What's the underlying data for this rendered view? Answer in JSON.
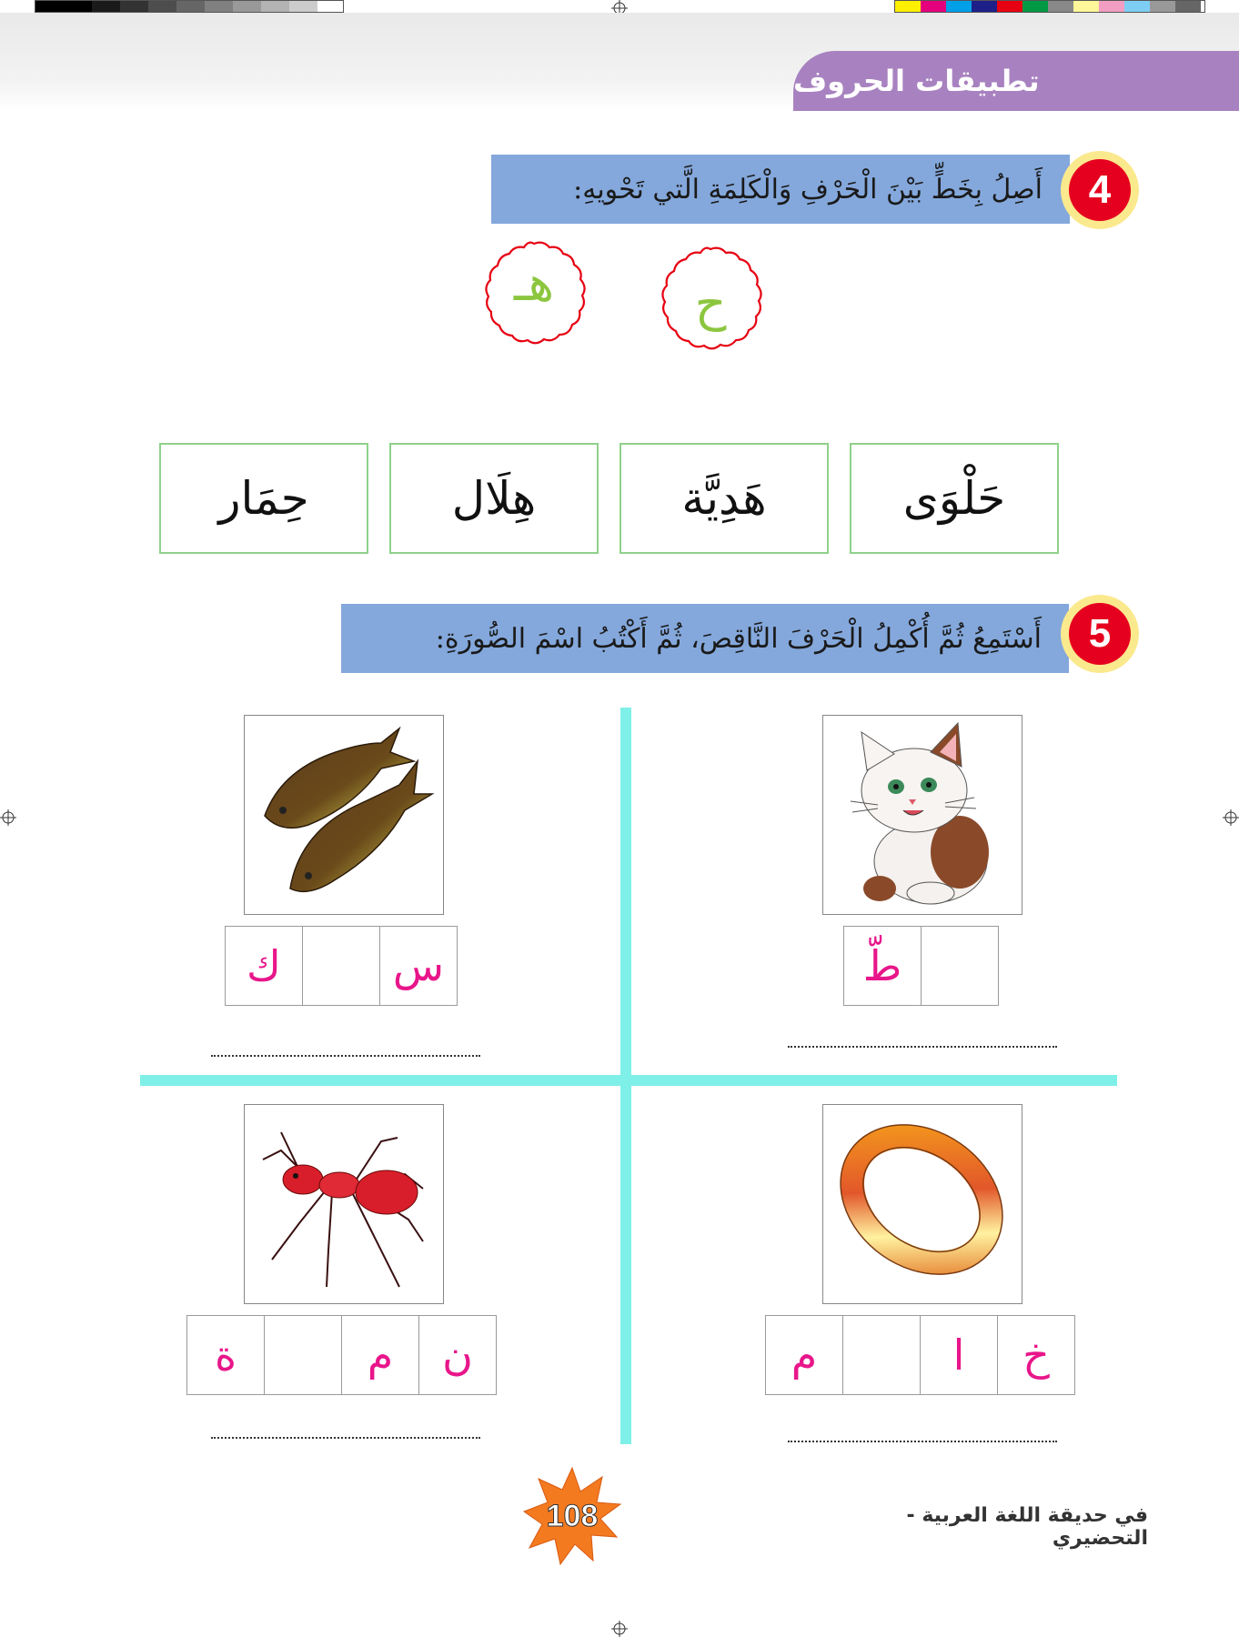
{
  "header": {
    "title": "تطبيقات الحروف"
  },
  "q4": {
    "number": "4",
    "instruction": "أَصِلُ بِخَطٍّ بَيْنَ الْحَرْفِ وَالْكَلِمَةِ الَّتي تَحْويهِ:",
    "letters": [
      "ح",
      "هـ"
    ],
    "words": [
      "حَلْوَى",
      "هَدِيَّة",
      "هِلَال",
      "حِمَار"
    ]
  },
  "q5": {
    "number": "5",
    "instruction": "أَسْتَمِعُ ثُمَّ أُكْمِلُ الْحَرْفَ النَّاقِصَ، ثُمَّ أَكْتُبُ اسْمَ الصُّورَةِ:",
    "items": [
      {
        "picture": "cat-picture",
        "cells": [
          "",
          "طّ"
        ]
      },
      {
        "picture": "fish-picture",
        "cells": [
          "س",
          "",
          "ك"
        ]
      },
      {
        "picture": "ring-picture",
        "cells": [
          "خ",
          "ا",
          "",
          "م"
        ]
      },
      {
        "picture": "ant-picture",
        "cells": [
          "ن",
          "م",
          "",
          "ة"
        ]
      }
    ],
    "answer_line": "................................................"
  },
  "footer": {
    "page_number": "108",
    "book_title": "في حديقة اللغة العربية - التحضيري"
  },
  "colors": {
    "accent_purple": "#a882c0",
    "bar_blue": "#84a8dc",
    "badge_red": "#e6001f",
    "letter_pink": "#e8168a",
    "letter_green": "#8cc63f",
    "divider_cyan": "#7ff0e8",
    "star_orange": "#f47a20"
  }
}
